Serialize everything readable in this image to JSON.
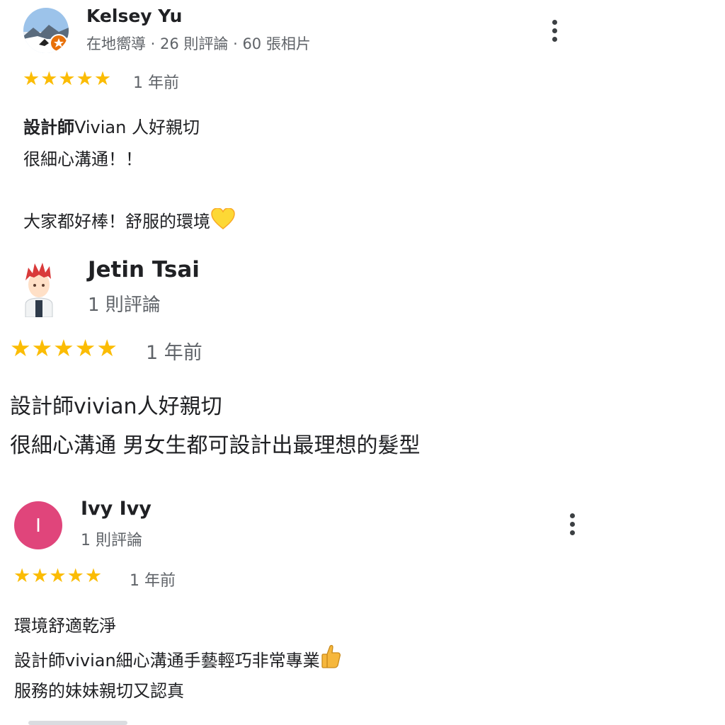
{
  "reviews": [
    {
      "name": "Kelsey Yu",
      "meta": "在地嚮導 · 26 則評論 · 60 張相片",
      "rating": 5,
      "stars": "★★★★★",
      "time": "1 年前",
      "lines": [
        "設計師Vivian 人好親切",
        "很細心溝通！！",
        "大家都好棒！舒服的環境"
      ],
      "avatar_icon": "mountain-photo-avatar",
      "badge_icon": "local-guide-badge",
      "trailing_emoji_icon": "yellow-heart-icon"
    },
    {
      "name": "Jetin Tsai",
      "meta": "1 則評論",
      "rating": 5,
      "stars": "★★★★★",
      "time": "1 年前",
      "lines": [
        "設計師vivian人好親切",
        "很細心溝通 男女生都可設計出最理想的髮型"
      ],
      "avatar_icon": "anime-character-avatar"
    },
    {
      "name": "Ivy Ivy",
      "meta": "1 則評論",
      "rating": 5,
      "stars": "★★★★★",
      "time": "1 年前",
      "avatar_letter": "I",
      "lines": [
        "環境舒適乾淨",
        "設計師vivian細心溝通手藝輕巧非常專業",
        "服務的妹妹親切又認真"
      ],
      "trailing_emoji_icon": "thumbs-up-icon"
    }
  ],
  "colors": {
    "star": "#fbbc04",
    "avatar_ivy": "#e0457b",
    "text": "#202124",
    "secondary": "#5f6368"
  }
}
